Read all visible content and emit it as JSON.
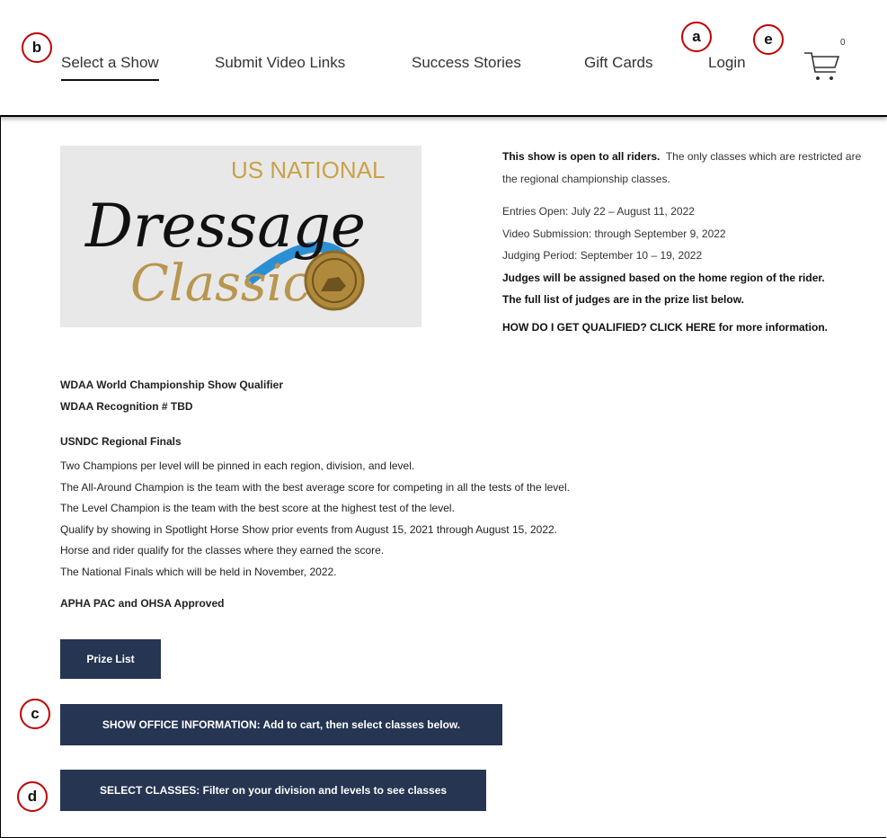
{
  "nav": {
    "items": [
      {
        "label": "Select a Show"
      },
      {
        "label": "Submit Video Links"
      },
      {
        "label": "Success Stories"
      },
      {
        "label": "Gift Cards"
      },
      {
        "label": "Login"
      }
    ],
    "cart_count": "0",
    "cart_icon": "cart-icon"
  },
  "callouts": {
    "a": "a",
    "b": "b",
    "c": "c",
    "d": "d",
    "e": "e",
    "color": "#c00000"
  },
  "logo": {
    "line1": "US NATIONAL",
    "line2": "Dressage",
    "line3": "Classic"
  },
  "info": {
    "open_bold": "This show is open to all riders.",
    "open_rest": "The only classes which are restricted are the regional championship classes.",
    "entries": "Entries Open: July 22 – August 11, 2022",
    "video": "Video Submission: through September 9, 2022",
    "judging": "Judging Period: September 10 – 19, 2022",
    "judges1": "Judges will be assigned based on the home region of the rider.",
    "judges2": "The full list of judges are in the prize list below.",
    "qualify": "HOW DO I GET QUALIFIED? CLICK HERE for more information."
  },
  "wdaa": {
    "line1": "WDAA World Championship Show Qualifier",
    "line2": "WDAA Recognition # TBD"
  },
  "usndc": {
    "title": "USNDC Regional Finals",
    "lines": [
      "Two Champions per level will be pinned in each region, division, and level.",
      "The All-Around Champion is the team with the best average score for competing in all the tests of the level.",
      "The Level Champion is the team with the best score at the highest test of the level.",
      "Qualify by showing in Spotlight Horse Show prior events from August 15, 2021 through August 15, 2022.",
      "Horse and rider qualify for the classes where they earned the score.",
      "The National Finals which will be held in November, 2022."
    ]
  },
  "approved": "APHA PAC and OHSA Approved",
  "buttons": {
    "prize_list": "Prize List",
    "show_office": "SHOW OFFICE INFORMATION: Add to cart, then select classes below.",
    "select_classes": "SELECT CLASSES: Filter on your division and levels to see classes",
    "color": "#253552"
  }
}
